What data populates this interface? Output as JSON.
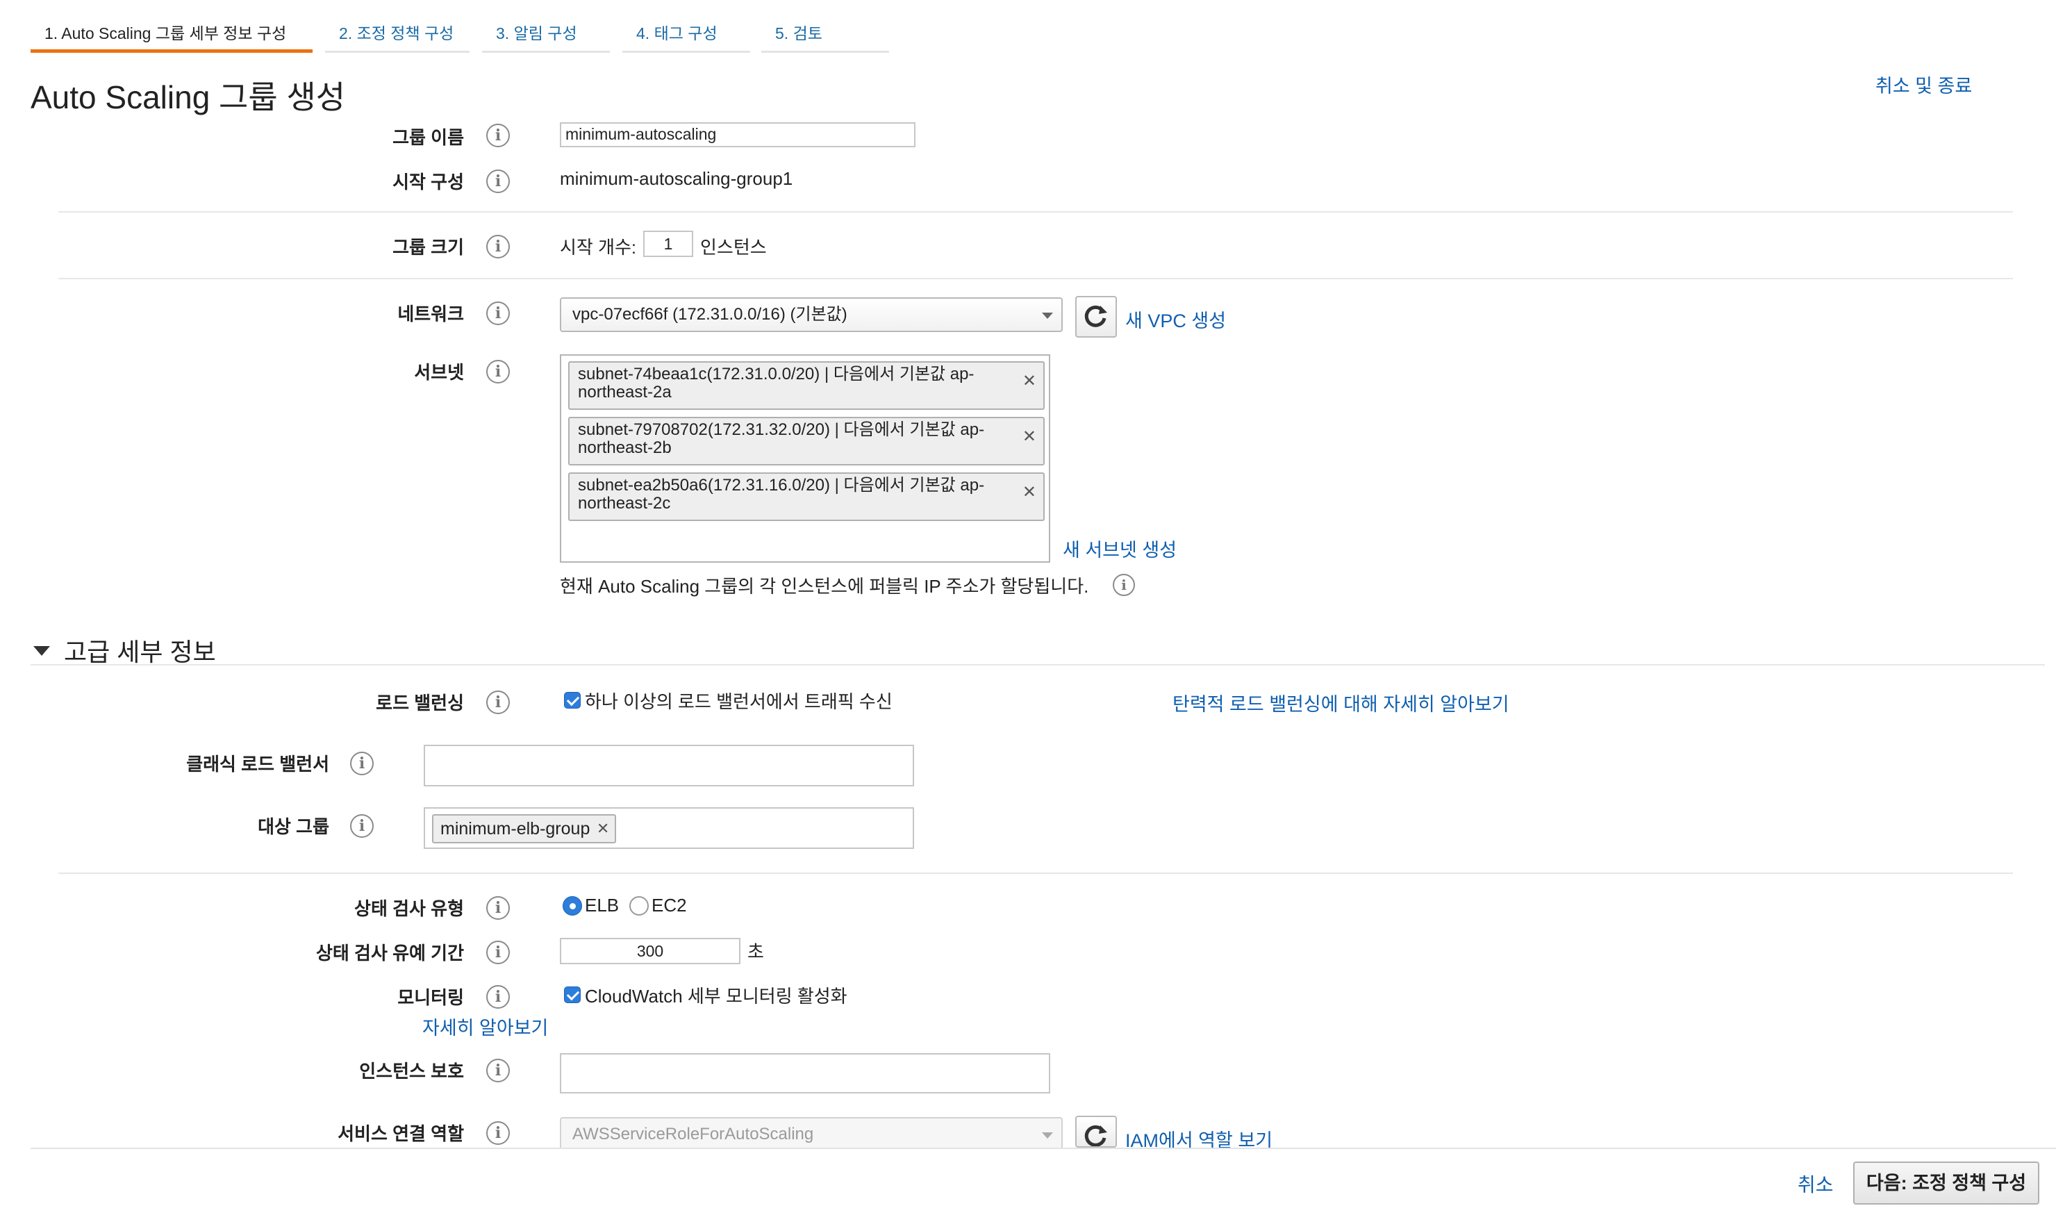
{
  "tabs": [
    {
      "label": "1. Auto Scaling 그룹 세부 정보 구성"
    },
    {
      "label": "2. 조정 정책 구성"
    },
    {
      "label": "3. 알림 구성"
    },
    {
      "label": "4. 태그 구성"
    },
    {
      "label": "5. 검토"
    }
  ],
  "header": {
    "title": "Auto Scaling 그룹 생성",
    "cancel_exit": "취소 및 종료"
  },
  "form": {
    "group_name": {
      "label": "그룹 이름",
      "value": "minimum-autoscaling"
    },
    "launch_config": {
      "label": "시작 구성",
      "value": "minimum-autoscaling-group1"
    },
    "group_size": {
      "label": "그룹 크기",
      "prefix": "시작 개수:",
      "value": "1",
      "suffix": "인스턴스"
    },
    "network": {
      "label": "네트워크",
      "value": "vpc-07ecf66f (172.31.0.0/16) (기본값)",
      "create_link": "새 VPC 생성"
    },
    "subnet": {
      "label": "서브넷",
      "items": [
        {
          "line1": "subnet-74beaa1c(172.31.0.0/20) | 다음에서 기본값 ap-",
          "line2": "northeast-2a"
        },
        {
          "line1": "subnet-79708702(172.31.32.0/20) | 다음에서 기본값 ap-",
          "line2": "northeast-2b"
        },
        {
          "line1": "subnet-ea2b50a6(172.31.16.0/20) | 다음에서 기본값 ap-",
          "line2": "northeast-2c"
        }
      ],
      "remove_glyph": "✕",
      "create_link": "새 서브넷 생성",
      "public_ip_note": "현재 Auto Scaling 그룹의 각 인스턴스에 퍼블릭 IP 주소가 할당됩니다."
    }
  },
  "advanced": {
    "heading": "고급 세부 정보",
    "load_balancing": {
      "label": "로드 밸런싱",
      "checkbox_label": "하나 이상의 로드 밸런서에서 트래픽 수신",
      "learn_link": "탄력적 로드 밸런싱에 대해 자세히 알아보기",
      "checked": true
    },
    "classic_lb": {
      "label": "클래식 로드 밸런서",
      "value": ""
    },
    "target_group": {
      "label": "대상 그룹",
      "chip": "minimum-elb-group"
    },
    "health_check_type": {
      "label": "상태 검사 유형",
      "options": [
        "ELB",
        "EC2"
      ],
      "selected": "ELB"
    },
    "health_check_grace": {
      "label": "상태 검사 유예 기간",
      "value": "300",
      "unit": "초"
    },
    "monitoring": {
      "label": "모니터링",
      "checkbox_label": "CloudWatch 세부 모니터링 활성화",
      "learn_link": "자세히 알아보기",
      "checked": true
    },
    "instance_protection": {
      "label": "인스턴스 보호",
      "value": ""
    },
    "service_role": {
      "label": "서비스 연결 역할",
      "value": "AWSServiceRoleForAutoScaling",
      "iam_link": "IAM에서 역할 보기"
    }
  },
  "footer": {
    "cancel": "취소",
    "next": "다음: 조정 정책 구성"
  },
  "colors": {
    "accent_tab": "#ec7211",
    "link": "#0f5fb0",
    "checkbox": "#2d7ddb"
  }
}
